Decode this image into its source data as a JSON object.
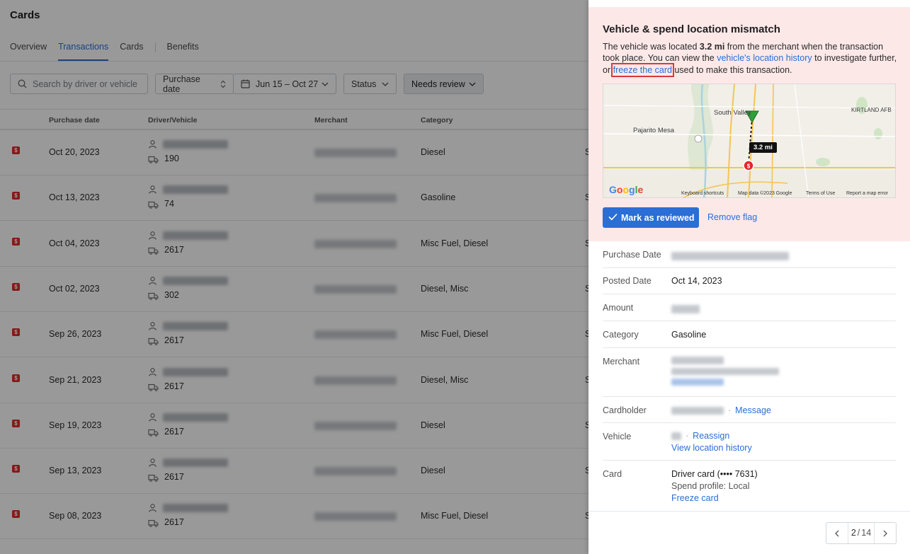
{
  "page": {
    "title": "Cards"
  },
  "tabs": [
    {
      "label": "Overview",
      "active": false
    },
    {
      "label": "Transactions",
      "active": true
    },
    {
      "label": "Cards",
      "active": false
    },
    {
      "label": "Benefits",
      "active": false
    }
  ],
  "filters": {
    "search_placeholder": "Search by driver or vehicle",
    "purchase_date_label": "Purchase date",
    "date_range": "Jun 15 – Oct 27",
    "status_label": "Status",
    "needs_review_label": "Needs review"
  },
  "table": {
    "headers": [
      "Purchase date",
      "Driver/Vehicle",
      "Merchant",
      "Category"
    ],
    "rows": [
      {
        "date": "Oct 20, 2023",
        "vehicle": "190",
        "category": "Diesel",
        "amount_prefix": "S"
      },
      {
        "date": "Oct 13, 2023",
        "vehicle": "74",
        "category": "Gasoline",
        "amount_prefix": "S"
      },
      {
        "date": "Oct 04, 2023",
        "vehicle": "2617",
        "category": "Misc Fuel, Diesel",
        "amount_prefix": "S"
      },
      {
        "date": "Oct 02, 2023",
        "vehicle": "302",
        "category": "Diesel, Misc",
        "amount_prefix": "S"
      },
      {
        "date": "Sep 26, 2023",
        "vehicle": "2617",
        "category": "Misc Fuel, Diesel",
        "amount_prefix": "S"
      },
      {
        "date": "Sep 21, 2023",
        "vehicle": "2617",
        "category": "Diesel, Misc",
        "amount_prefix": "S"
      },
      {
        "date": "Sep 19, 2023",
        "vehicle": "2617",
        "category": "Diesel",
        "amount_prefix": "S"
      },
      {
        "date": "Sep 13, 2023",
        "vehicle": "2617",
        "category": "Diesel",
        "amount_prefix": "S"
      },
      {
        "date": "Sep 08, 2023",
        "vehicle": "2617",
        "category": "Misc Fuel, Diesel",
        "amount_prefix": "S"
      }
    ]
  },
  "panel": {
    "alert": {
      "title": "Vehicle & spend location mismatch",
      "text_1": "The vehicle was located ",
      "distance_bold": "3.2 mi",
      "text_2": " from the merchant when the transaction took place. You can view the ",
      "link_history": "vehicle's location history",
      "text_3": " to investigate further, or ",
      "link_freeze": "freeze the card",
      "text_4": " used to make this transaction."
    },
    "map": {
      "labels": [
        "South Valley",
        "Pajarito Mesa",
        "KIRTLAND AFB"
      ],
      "distance_tag": "3.2 mi",
      "google": "Google",
      "footer": [
        "Keyboard shortcuts",
        "Map data ©2023 Google",
        "Terms of Use",
        "Report a map error"
      ]
    },
    "mark_reviewed": "Mark as reviewed",
    "remove_flag": "Remove flag",
    "details": {
      "purchase_date_label": "Purchase Date",
      "posted_date_label": "Posted Date",
      "posted_date_value": "Oct 14, 2023",
      "amount_label": "Amount",
      "category_label": "Category",
      "category_value": "Gasoline",
      "merchant_label": "Merchant",
      "cardholder_label": "Cardholder",
      "message_link": "Message",
      "vehicle_label": "Vehicle",
      "reassign_link": "Reassign",
      "view_history_link": "View location history",
      "card_label": "Card",
      "card_value": "Driver card (•••• 7631)",
      "spend_profile": "Spend profile: Local",
      "freeze_card_link": "Freeze card"
    },
    "pager": {
      "current": "2",
      "separator": "/",
      "total": "14"
    }
  }
}
